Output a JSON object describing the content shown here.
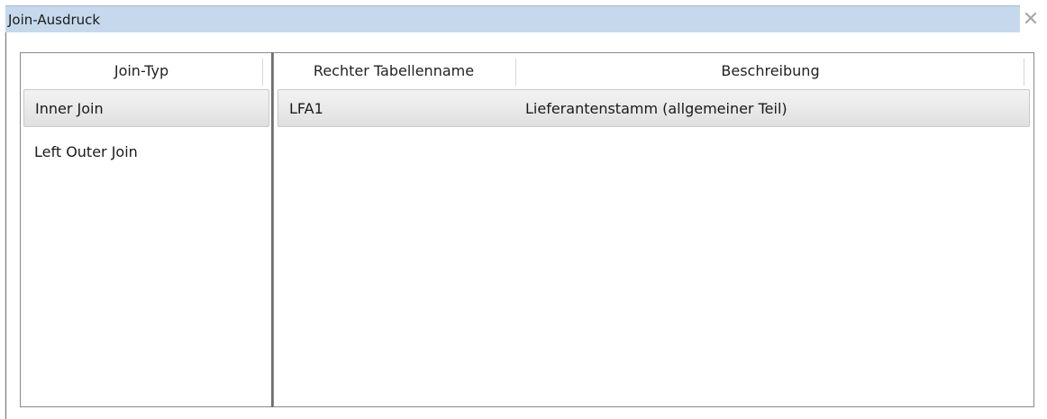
{
  "window": {
    "title": "Join-Ausdruck"
  },
  "join_types": {
    "header": "Join-Typ",
    "items": [
      {
        "label": "Inner Join",
        "selected": true
      },
      {
        "label": "Left Outer Join",
        "selected": false
      }
    ]
  },
  "tables": {
    "headers": {
      "right_table_name": "Rechter Tabellenname",
      "description": "Beschreibung"
    },
    "rows": [
      {
        "name": "LFA1",
        "description": "Lieferantenstamm (allgemeiner Teil)",
        "selected": true
      }
    ]
  },
  "colors": {
    "titlebar": "#c6d9ec",
    "selection": "#e6e6e6",
    "border": "#8a8a8a"
  }
}
